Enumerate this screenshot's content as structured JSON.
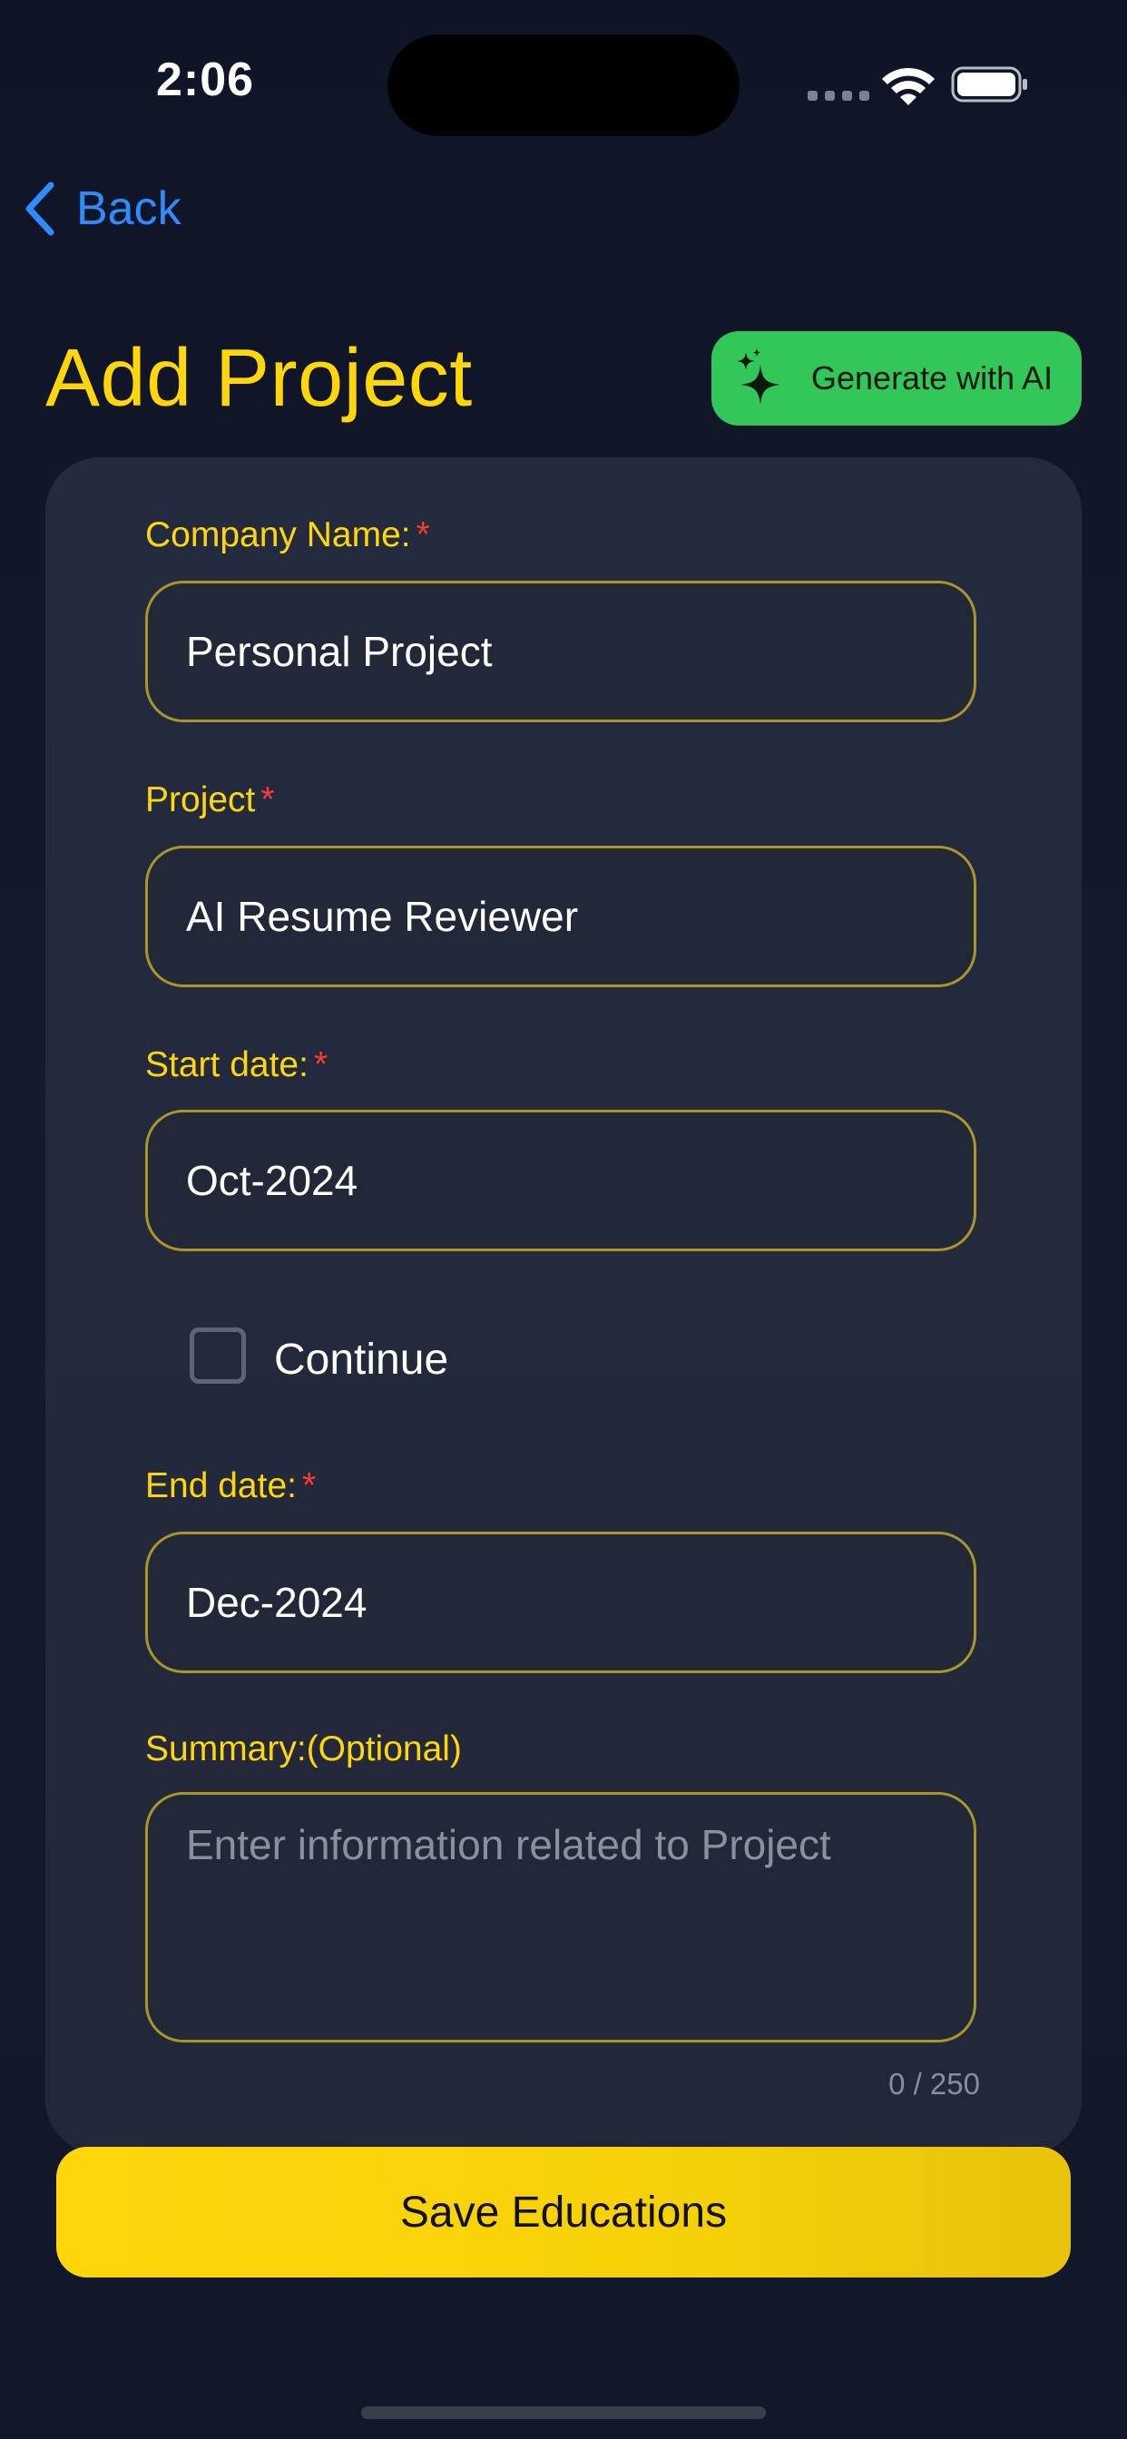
{
  "status_bar": {
    "time": "2:06"
  },
  "nav": {
    "back_label": "Back"
  },
  "header": {
    "title": "Add Project",
    "generate_label": "Generate with AI"
  },
  "form": {
    "company": {
      "label": "Company Name:",
      "required_mark": "*",
      "value": "Personal Project"
    },
    "project": {
      "label": "Project",
      "required_mark": "*",
      "value": "AI Resume Reviewer"
    },
    "start_date": {
      "label": "Start date:",
      "required_mark": "*",
      "value": "Oct-2024"
    },
    "continue": {
      "label": "Continue",
      "checked": false
    },
    "end_date": {
      "label": "End date:",
      "required_mark": "*",
      "value": "Dec-2024"
    },
    "summary": {
      "label": "Summary:(Optional)",
      "placeholder": "Enter information related to Project",
      "counter": "0 / 250"
    }
  },
  "save_button": {
    "label": "Save Educations"
  },
  "colors": {
    "accent_yellow": "#ffd60a",
    "ai_green": "#33c759",
    "link_blue": "#2f8cff",
    "required_red": "#ff3b30",
    "background": "#121829"
  }
}
